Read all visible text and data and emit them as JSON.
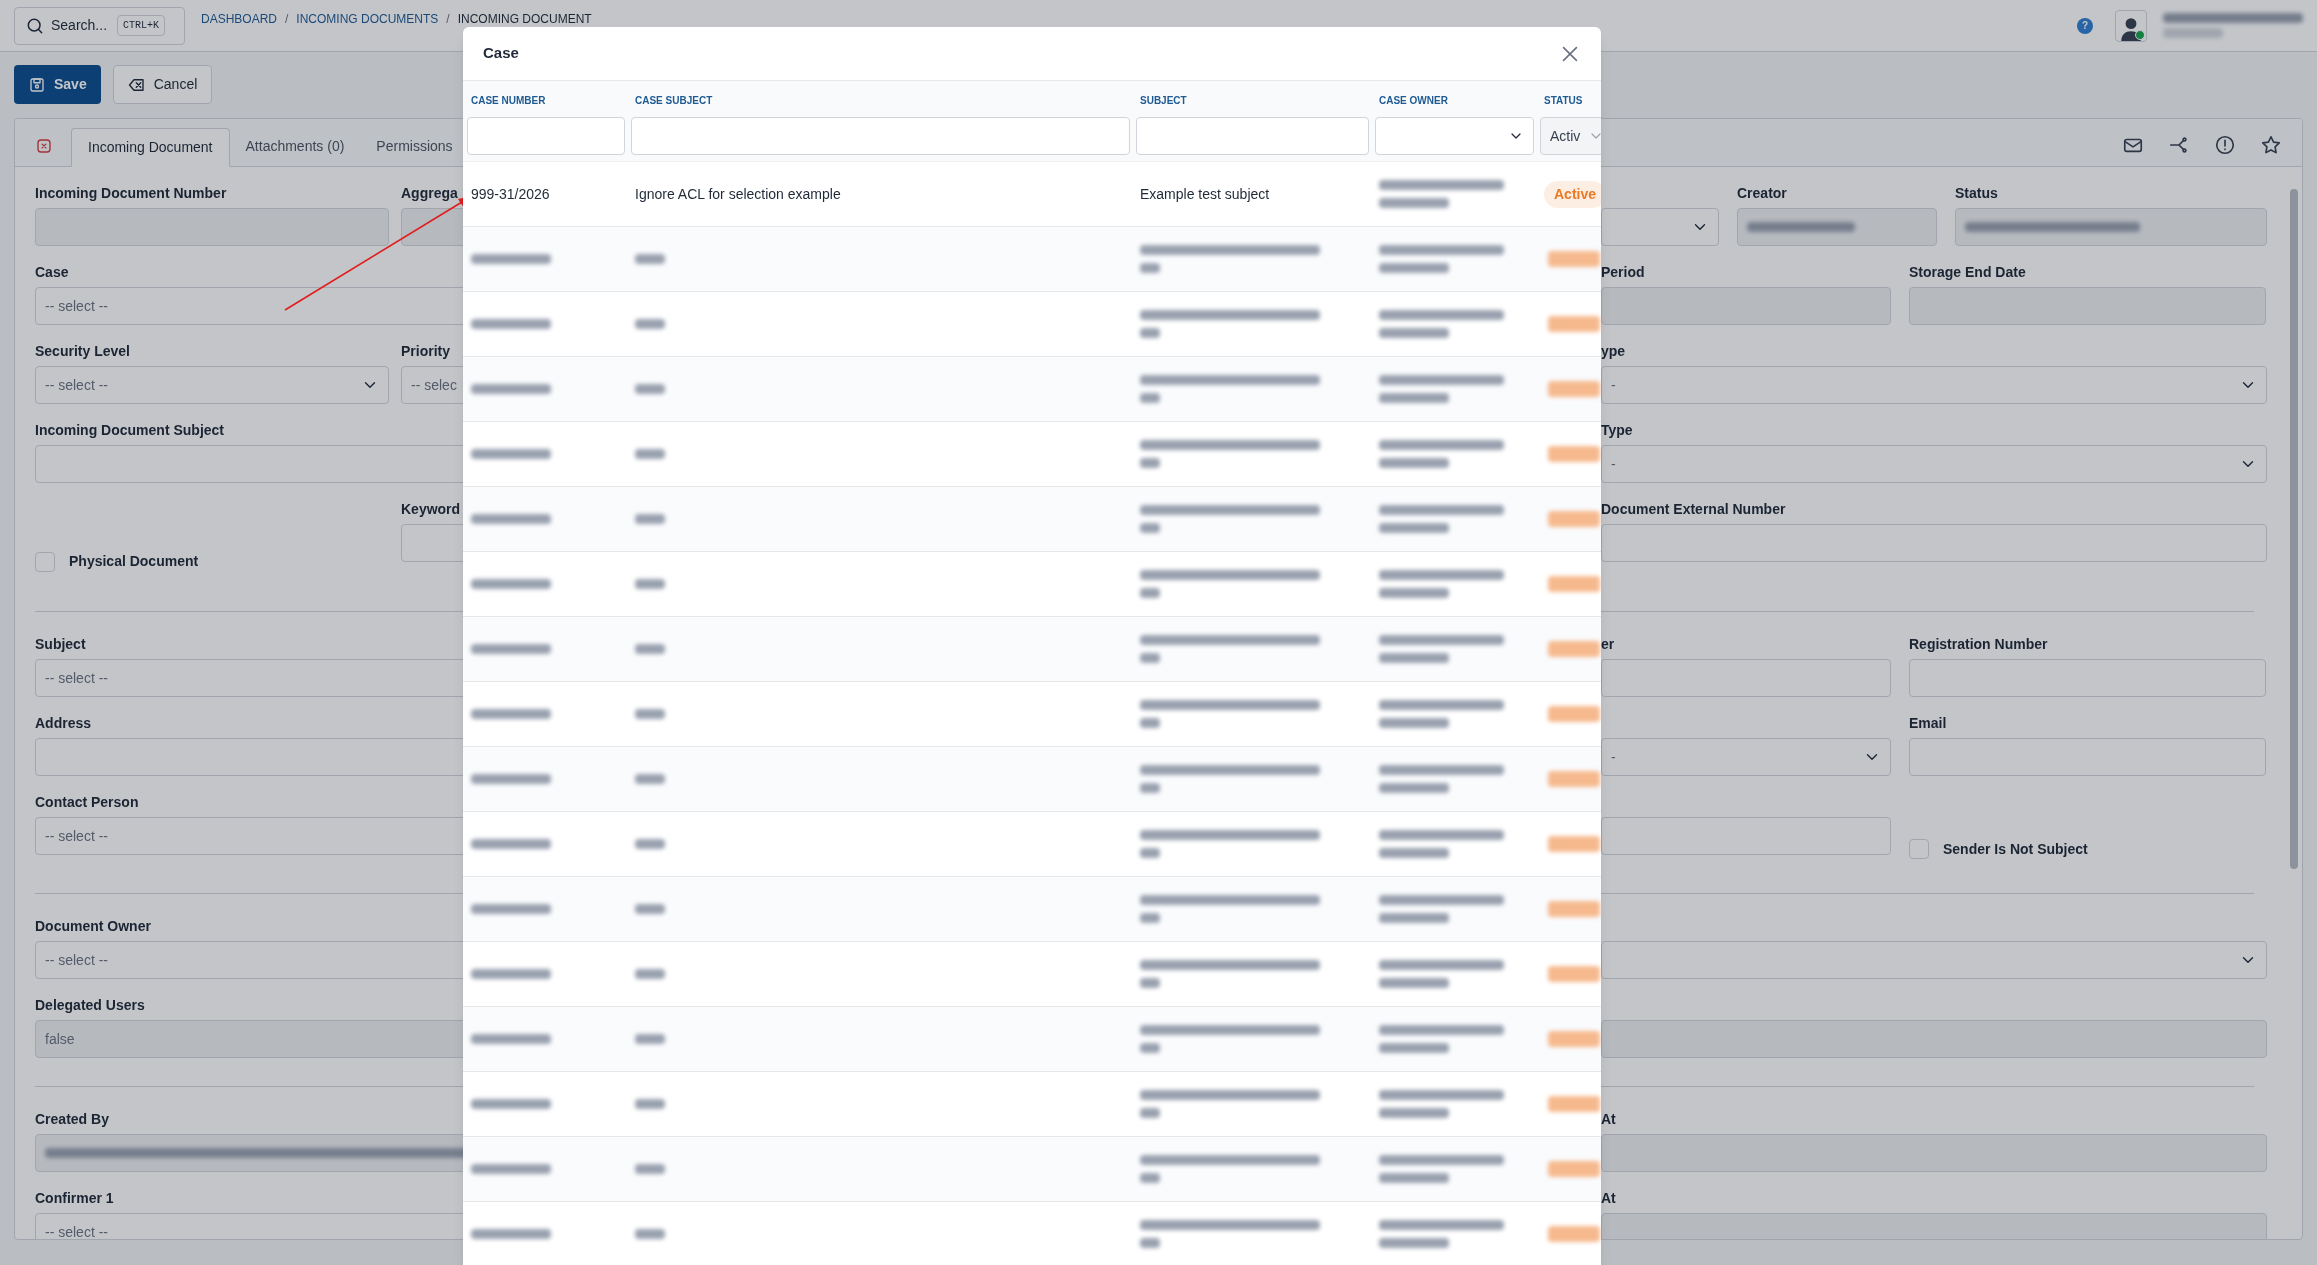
{
  "top_bar": {
    "search": {
      "label": "Search...",
      "shortcut": "CTRL+K"
    },
    "breadcrumbs": [
      {
        "label": "DASHBOARD",
        "separator": "/"
      },
      {
        "label": "INCOMING DOCUMENTS",
        "separator": "/"
      },
      {
        "label": "INCOMING DOCUMENT"
      }
    ],
    "help": "?",
    "user": {
      "name_redacted": true,
      "online": true
    }
  },
  "toolbar": {
    "buttons": [
      {
        "label": "Save",
        "kind": "primary"
      },
      {
        "label": "Cancel",
        "kind": "secondary"
      }
    ]
  },
  "tabs": [
    {
      "label": "Incoming Document",
      "selected": true
    },
    {
      "label": "Attachments (0)",
      "selected": false
    },
    {
      "label": "Permissions",
      "selected": false
    }
  ],
  "sections": [
    {
      "rows": [
        {
          "left": [
            {
              "label": "Incoming Document Number",
              "kind": "input",
              "disabled": true,
              "blurred": false
            },
            {
              "label": "Aggrega",
              "kind": "input",
              "disabled": true,
              "blurred": false
            }
          ],
          "right": [
            {
              "kind": "select",
              "disabled": false,
              "blurred": false
            },
            {
              "label": "Creator",
              "kind": "input",
              "disabled": true,
              "blurred": true
            },
            {
              "label": "Status",
              "kind": "input",
              "disabled": true,
              "blurred": true
            }
          ]
        },
        {
          "left": [
            {
              "label": "Case",
              "kind": "input",
              "placeholder": "-- select --",
              "disabled": false,
              "blurred": false
            }
          ],
          "right": [
            {
              "label": "Period",
              "kind": "input",
              "disabled": true,
              "blurred": false
            },
            {
              "label": "Storage End Date",
              "kind": "input",
              "disabled": true,
              "blurred": false
            }
          ]
        },
        {
          "left": [
            {
              "label": "Security Level",
              "kind": "select",
              "placeholder": "-- select --",
              "disabled": false,
              "blurred": false
            },
            {
              "label": "Priority",
              "kind": "input",
              "placeholder": "-- selec",
              "disabled": false,
              "blurred": false
            }
          ],
          "right": [
            {
              "label": "ype",
              "kind": "select",
              "placeholder": "-",
              "disabled": false,
              "blurred": false
            }
          ]
        },
        {
          "left": [
            {
              "label": "Incoming Document Subject",
              "kind": "input",
              "disabled": false,
              "blurred": false
            }
          ],
          "right": [
            {
              "label": "Type",
              "kind": "select",
              "placeholder": "-",
              "disabled": false,
              "blurred": false
            }
          ]
        },
        {
          "left": [
            {
              "label": "Physical Document",
              "kind": "checkbox",
              "checked": false
            },
            {
              "label": "Keyword",
              "kind": "input",
              "disabled": false,
              "blurred": false
            }
          ],
          "right": [
            {
              "label": "Document External Number",
              "kind": "input",
              "disabled": false,
              "blurred": false
            }
          ]
        }
      ]
    },
    {
      "rows": [
        {
          "left": [
            {
              "label": "Subject",
              "kind": "input",
              "placeholder": "-- select --",
              "disabled": false,
              "blurred": false
            }
          ],
          "right": [
            {
              "label": "er",
              "kind": "input",
              "disabled": false,
              "blurred": false
            },
            {
              "label": "Registration Number",
              "kind": "input",
              "disabled": false,
              "blurred": false
            }
          ]
        },
        {
          "left": [
            {
              "label": "Address",
              "kind": "input",
              "disabled": false,
              "blurred": false
            }
          ],
          "right": [
            {
              "kind": "select",
              "placeholder": "-",
              "disabled": false,
              "blurred": false
            },
            {
              "label": "Email",
              "kind": "input",
              "disabled": false,
              "blurred": false
            }
          ]
        },
        {
          "left": [
            {
              "label": "Contact Person",
              "kind": "input",
              "placeholder": "-- select --",
              "disabled": false,
              "blurred": false
            }
          ],
          "right": [
            {
              "kind": "input",
              "disabled": false,
              "blurred": false
            },
            {
              "label": "Sender Is Not Subject",
              "kind": "checkbox",
              "checked": false
            }
          ]
        }
      ]
    },
    {
      "rows": [
        {
          "left": [
            {
              "label": "Document Owner",
              "kind": "input",
              "placeholder": "-- select --",
              "disabled": false,
              "blurred": false
            }
          ],
          "right": [
            {
              "kind": "select",
              "disabled": false,
              "blurred": false
            }
          ]
        },
        {
          "left": [
            {
              "label": "Delegated Users",
              "kind": "input",
              "value": "false",
              "disabled": true,
              "blurred": false
            }
          ],
          "right": [
            {
              "kind": "input",
              "disabled": true,
              "blurred": false
            }
          ]
        }
      ]
    },
    {
      "rows": [
        {
          "left": [
            {
              "label": "Created By",
              "kind": "input",
              "disabled": true,
              "blurred": true
            }
          ],
          "right": [
            {
              "label": "At",
              "kind": "input",
              "disabled": true,
              "blurred": false
            }
          ]
        },
        {
          "left": [
            {
              "label": "Confirmer 1",
              "kind": "input",
              "placeholder": "-- select --",
              "disabled": false,
              "blurred": false
            }
          ],
          "right": [
            {
              "label": "At",
              "kind": "input",
              "disabled": true,
              "blurred": false
            }
          ]
        }
      ]
    }
  ],
  "modal": {
    "title": "Case",
    "columns": [
      {
        "label": "CASE NUMBER",
        "kind": "input"
      },
      {
        "label": "CASE SUBJECT",
        "kind": "input"
      },
      {
        "label": "SUBJECT",
        "kind": "input"
      },
      {
        "label": "CASE OWNER",
        "kind": "select"
      },
      {
        "label": "STATUS",
        "kind": "select",
        "filter_value": "Activ"
      }
    ],
    "rows": [
      {
        "kind": "text",
        "case_number": "999-31/2026",
        "case_subject": "Ignore ACL for selection example",
        "subject": "Example test subject",
        "owner_redacted": true,
        "status": "Active"
      },
      {
        "kind": "redacted"
      },
      {
        "kind": "redacted"
      },
      {
        "kind": "redacted"
      },
      {
        "kind": "redacted"
      },
      {
        "kind": "redacted"
      },
      {
        "kind": "redacted"
      },
      {
        "kind": "redacted"
      },
      {
        "kind": "redacted"
      },
      {
        "kind": "redacted"
      },
      {
        "kind": "redacted"
      },
      {
        "kind": "redacted"
      },
      {
        "kind": "redacted"
      },
      {
        "kind": "redacted"
      },
      {
        "kind": "redacted"
      },
      {
        "kind": "redacted"
      },
      {
        "kind": "redacted"
      }
    ]
  }
}
